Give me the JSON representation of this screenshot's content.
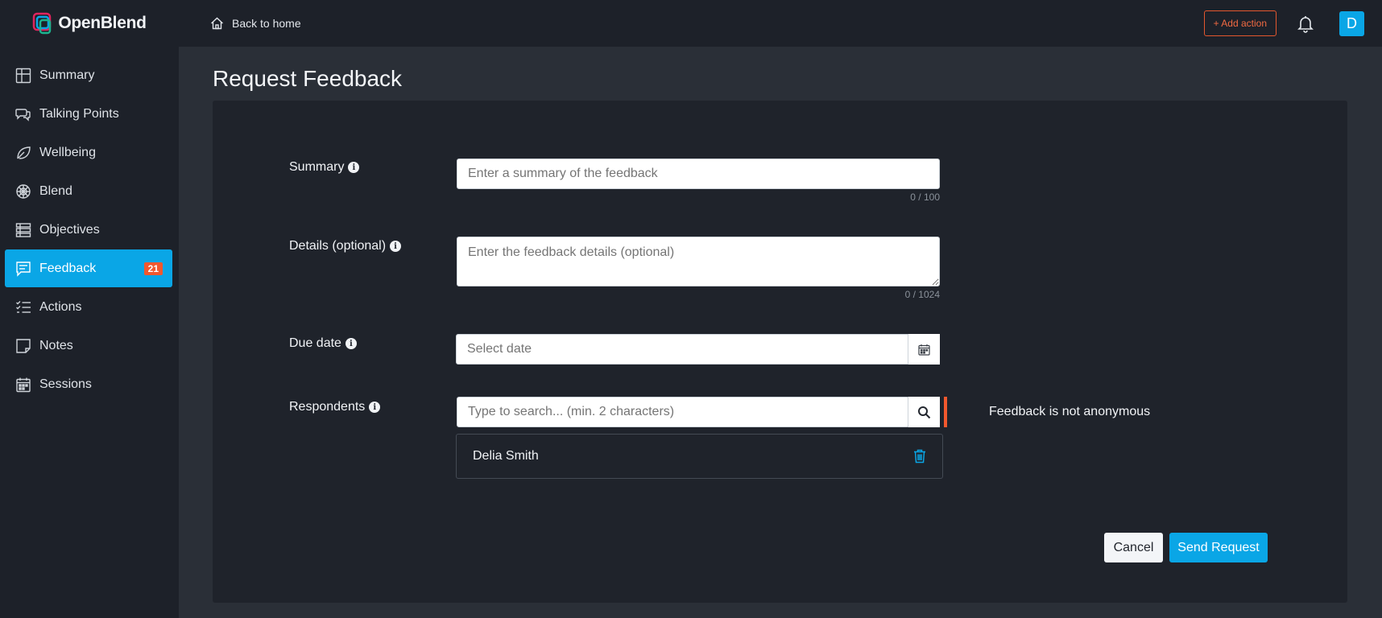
{
  "app": {
    "logo_text": "OpenBlend",
    "accent_color": "#0aa6e6",
    "warning_color": "#f2582e"
  },
  "sidebar": {
    "items": [
      {
        "label": "Summary",
        "icon": "grid-icon"
      },
      {
        "label": "Talking Points",
        "icon": "chat-bubbles-icon"
      },
      {
        "label": "Wellbeing",
        "icon": "leaf-icon"
      },
      {
        "label": "Blend",
        "icon": "web-icon"
      },
      {
        "label": "Objectives",
        "icon": "list-layers-icon"
      },
      {
        "label": "Feedback",
        "icon": "comment-icon",
        "badge": "21",
        "active": true
      },
      {
        "label": "Actions",
        "icon": "checklist-icon"
      },
      {
        "label": "Notes",
        "icon": "sticky-note-icon"
      },
      {
        "label": "Sessions",
        "icon": "calendar-icon"
      }
    ]
  },
  "topbar": {
    "back_label": "Back to home",
    "add_action_label": "+ Add action",
    "avatar_initial": "D"
  },
  "page": {
    "title": "Request Feedback"
  },
  "form": {
    "summary": {
      "label": "Summary",
      "placeholder": "Enter a summary of the feedback",
      "counter": "0 / 100"
    },
    "details": {
      "label": "Details (optional)",
      "placeholder": "Enter the feedback details (optional)",
      "counter": "0 / 1024"
    },
    "due_date": {
      "label": "Due date",
      "placeholder": "Select date"
    },
    "respondents": {
      "label": "Respondents",
      "placeholder": "Type to search... (min. 2 characters)",
      "selected": [
        "Delia Smith"
      ],
      "anonymity_note": "Feedback is not anonymous"
    },
    "cancel_label": "Cancel",
    "send_label": "Send Request"
  }
}
